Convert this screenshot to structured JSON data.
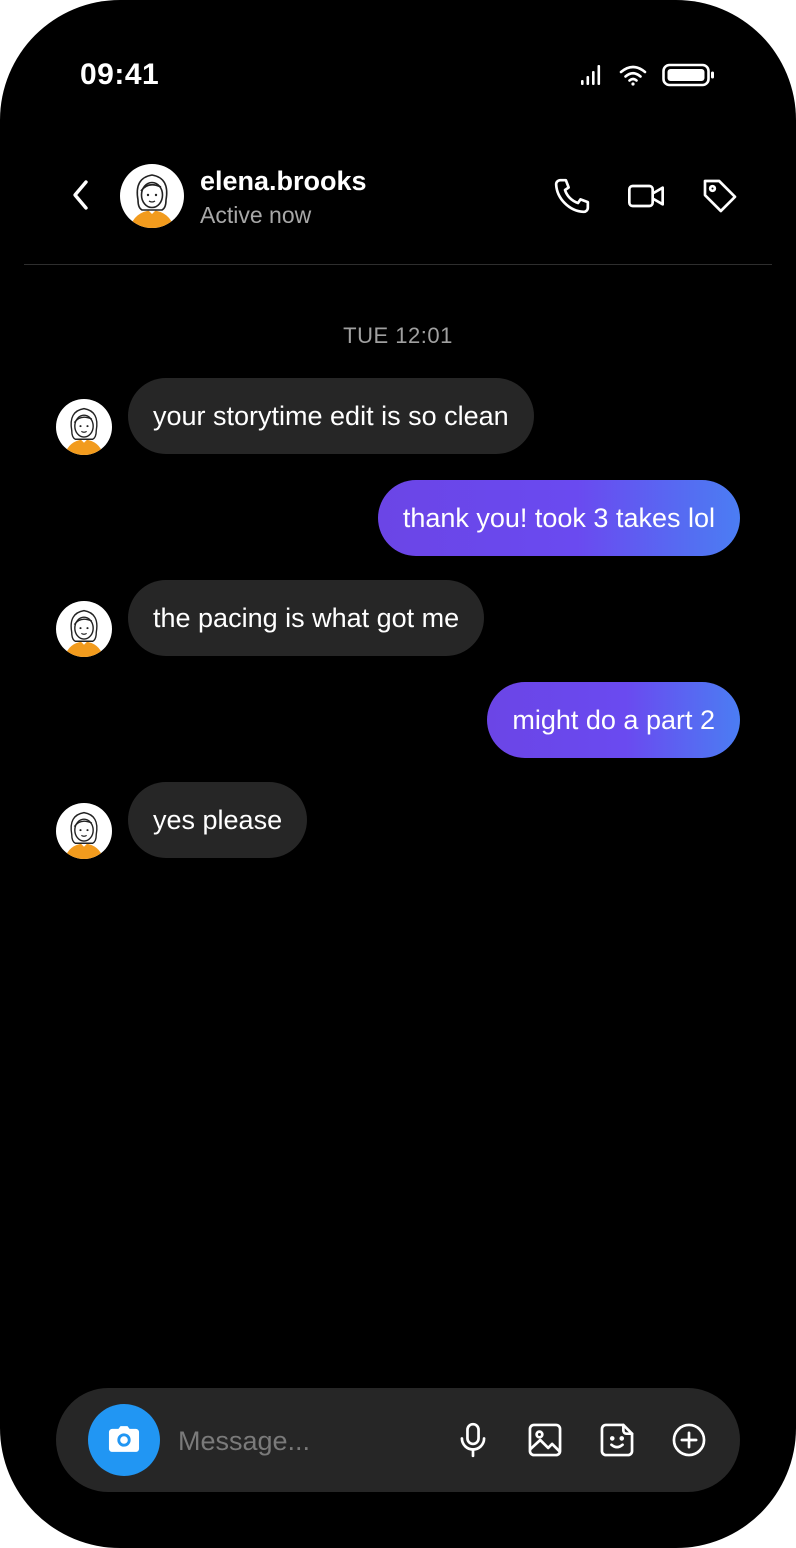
{
  "status_bar": {
    "time": "09:41",
    "signal_icon": "cellular-signal-icon",
    "wifi_icon": "wifi-icon",
    "battery_icon": "battery-icon"
  },
  "header": {
    "back_icon": "chevron-left-icon",
    "contact_name": "elena.brooks",
    "contact_status": "Active now",
    "actions": [
      "phone-icon",
      "video-camera-icon",
      "tag-icon"
    ]
  },
  "chat": {
    "timestamp": "TUE 12:01",
    "messages": [
      {
        "direction": "incoming",
        "text": "your storytime edit is so clean"
      },
      {
        "direction": "outgoing",
        "text": "thank you! took 3 takes lol"
      },
      {
        "direction": "incoming",
        "text": "the pacing is what got me"
      },
      {
        "direction": "outgoing",
        "text": "might do a part 2"
      },
      {
        "direction": "incoming",
        "text": "yes please"
      }
    ]
  },
  "composer": {
    "placeholder": "Message...",
    "camera_icon": "camera-icon",
    "actions": [
      "microphone-icon",
      "image-icon",
      "sticker-icon",
      "plus-circle-icon"
    ]
  },
  "colors": {
    "accent_blue": "#2196f3",
    "outgoing_gradient_start": "#6b45e6",
    "outgoing_gradient_end": "#4b7df3",
    "incoming_bubble": "#262626",
    "background": "#000000"
  }
}
